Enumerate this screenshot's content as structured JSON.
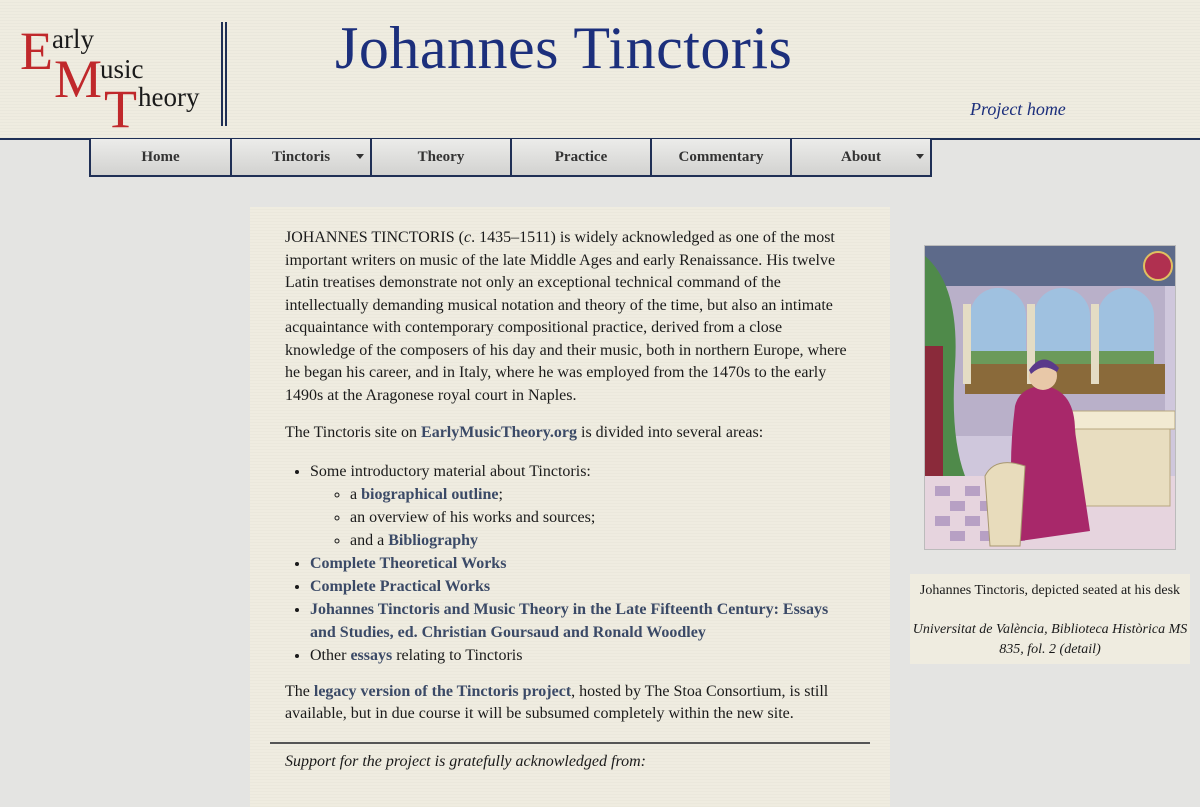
{
  "logo": {
    "line1_cap": "E",
    "line1_rest": "arly",
    "line2_cap": "M",
    "line2_rest": "usic",
    "line3_cap": "T",
    "line3_rest": "heory",
    "color_accent": "#c0282b"
  },
  "header": {
    "title": "Johannes Tinctoris",
    "project_home": "Project home",
    "title_color": "#1c2f7c"
  },
  "nav": {
    "items": [
      {
        "label": "Home",
        "dropdown": false
      },
      {
        "label": "Tinctoris",
        "dropdown": true
      },
      {
        "label": "Theory",
        "dropdown": false
      },
      {
        "label": "Practice",
        "dropdown": false
      },
      {
        "label": "Commentary",
        "dropdown": false
      },
      {
        "label": "About",
        "dropdown": true
      }
    ]
  },
  "main": {
    "intro": {
      "name": "JOHANNES TINCTORIS (",
      "circa": "c",
      "rest": ". 1435–1511) is widely acknowledged as one of the most important writers on music of the late Middle Ages and early Renaissance. His twelve Latin treatises demonstrate not only an exceptional technical command of the intellectually demanding musical notation and theory of the time, but also an intimate acquaintance with contemporary compositional practice, derived from a close knowledge of the composers of his day and their music, both in northern Europe, where he began his career, and in Italy, where he was employed from the 1470s to the early 1490s at the Aragonese royal court in Naples."
    },
    "site_para": {
      "before": "The Tinctoris site on ",
      "link": "EarlyMusicTheory.org",
      "after": " is divided into several areas:"
    },
    "list": {
      "intro_item": "Some introductory material about Tinctoris:",
      "sub1_before": "a ",
      "sub1_link": "biographical outline",
      "sub1_after": ";",
      "sub2": "an overview of his works and sources;",
      "sub3_before": "and a ",
      "sub3_link": "Bibliography",
      "item2": "Complete Theoretical Works",
      "item3": "Complete Practical Works",
      "item4": "Johannes Tinctoris and Music Theory in the Late Fifteenth Century: Essays and Studies, ed. Christian Goursaud and Ronald Woodley",
      "item5_before": "Other ",
      "item5_link": "essays",
      "item5_after": " relating to Tinctoris"
    },
    "legacy": {
      "before": "The ",
      "link": "legacy version of the Tinctoris project",
      "after": ", hosted by The Stoa Consortium, is still available, but in due course it will be subsumed completely within the new site."
    },
    "support": "Support for the project is gratefully acknowledged from:"
  },
  "sidebar": {
    "caption_line1": "Johannes Tinctoris, depicted seated at his desk",
    "caption_line2": "Universitat de València, Biblioteca Històrica MS 835, fol. 2 (detail)"
  }
}
